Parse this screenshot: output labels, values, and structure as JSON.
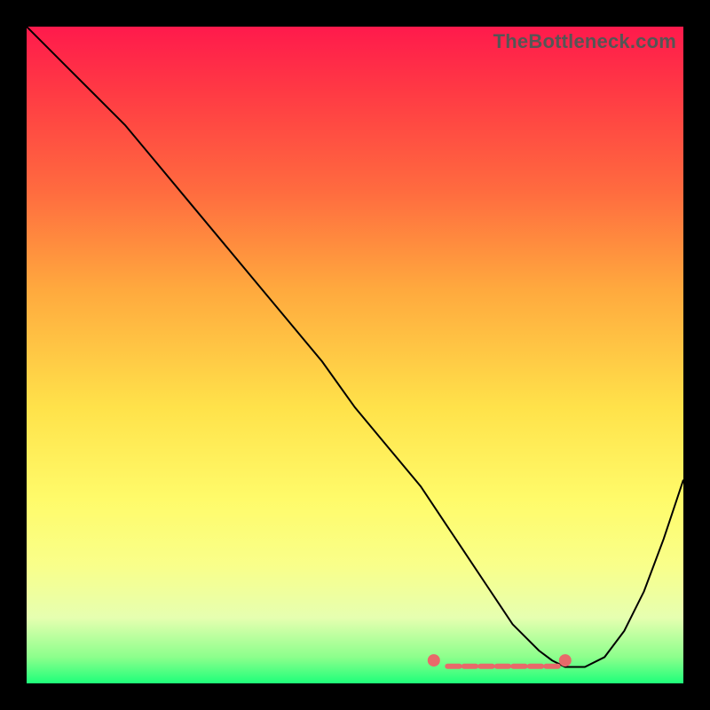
{
  "brand": "TheBottleneck.com",
  "chart_data": {
    "type": "line",
    "title": "",
    "xlabel": "",
    "ylabel": "",
    "xlim": [
      0,
      100
    ],
    "ylim": [
      0,
      100
    ],
    "series": [
      {
        "name": "bottleneck-curve",
        "x": [
          0,
          3,
          6,
          10,
          15,
          20,
          25,
          30,
          35,
          40,
          45,
          50,
          55,
          60,
          62,
          64,
          66,
          68,
          70,
          72,
          74,
          76,
          78,
          80,
          82,
          85,
          88,
          91,
          94,
          97,
          100
        ],
        "y": [
          100,
          97,
          94,
          90,
          85,
          79,
          73,
          67,
          61,
          55,
          49,
          42,
          36,
          30,
          27,
          24,
          21,
          18,
          15,
          12,
          9,
          7,
          5,
          3.5,
          2.5,
          2.5,
          4,
          8,
          14,
          22,
          31
        ]
      }
    ],
    "markers": {
      "name": "sweet-spot",
      "points": [
        {
          "x": 62,
          "y": 3.5
        },
        {
          "x": 82,
          "y": 3.5
        }
      ],
      "dash_x": [
        65,
        67.5,
        70,
        72.5,
        75,
        77.5,
        80
      ],
      "dash_y": 2.6
    }
  }
}
